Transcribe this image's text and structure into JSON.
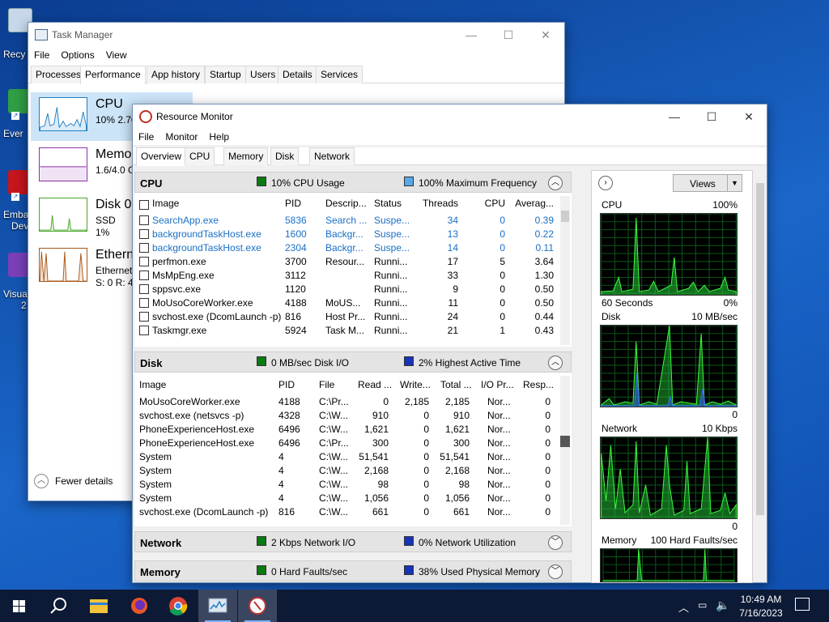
{
  "desktop": {
    "icons": [
      {
        "label": "Recy",
        "color": "#c8d8ea"
      },
      {
        "label": "Ever",
        "color": "#2f9e44"
      },
      {
        "label": "Emba",
        "sub": "Dev",
        "color": "#c4161c"
      },
      {
        "label": "Visua",
        "sub": "2",
        "color": "#7b3fb8"
      }
    ]
  },
  "task_manager": {
    "title": "Task Manager",
    "menu": [
      "File",
      "Options",
      "View"
    ],
    "tabs": [
      "Processes",
      "Performance",
      "App history",
      "Startup",
      "Users",
      "Details",
      "Services"
    ],
    "active_tab": "Performance",
    "sidebar": [
      {
        "name": "CPU",
        "sub1": "10% 2.70",
        "color": "#1f80c6"
      },
      {
        "name": "Memo",
        "sub1": "1.6/4.0 G",
        "color": "#8b2fa8"
      },
      {
        "name": "Disk 0",
        "sub1": "SSD",
        "sub2": "1%",
        "color": "#4aa529"
      },
      {
        "name": "Ethern",
        "sub1": "Ethernet",
        "sub2": "S: 0 R: 40",
        "color": "#a7581b"
      }
    ],
    "fewer_details": "Fewer details",
    "fewer_icon": "chevron-up-icon"
  },
  "resource_monitor": {
    "title": "Resource Monitor",
    "menu": [
      "File",
      "Monitor",
      "Help"
    ],
    "tabs": [
      "Overview",
      "CPU",
      "Memory",
      "Disk",
      "Network"
    ],
    "active_tab": "Overview",
    "cpu_section": {
      "title": "CPU",
      "ind1": {
        "text": "10% CPU Usage",
        "color": "#0a7a12"
      },
      "ind2": {
        "text": "100% Maximum Frequency",
        "color": "#5aa8e8"
      },
      "columns": [
        "Image",
        "PID",
        "Descrip...",
        "Status",
        "Threads",
        "CPU",
        "Averag..."
      ],
      "rows": [
        {
          "image": "SearchApp.exe",
          "pid": "5836",
          "desc": "Search ...",
          "status": "Suspe...",
          "threads": "34",
          "cpu": "0",
          "avg": "0.39",
          "blue": true
        },
        {
          "image": "backgroundTaskHost.exe",
          "pid": "1600",
          "desc": "Backgr...",
          "status": "Suspe...",
          "threads": "13",
          "cpu": "0",
          "avg": "0.22",
          "blue": true
        },
        {
          "image": "backgroundTaskHost.exe",
          "pid": "2304",
          "desc": "Backgr...",
          "status": "Suspe...",
          "threads": "14",
          "cpu": "0",
          "avg": "0.11",
          "blue": true
        },
        {
          "image": "perfmon.exe",
          "pid": "3700",
          "desc": "Resour...",
          "status": "Runni...",
          "threads": "17",
          "cpu": "5",
          "avg": "3.64",
          "blue": false
        },
        {
          "image": "MsMpEng.exe",
          "pid": "3112",
          "desc": "",
          "status": "Runni...",
          "threads": "33",
          "cpu": "0",
          "avg": "1.30",
          "blue": false
        },
        {
          "image": "sppsvc.exe",
          "pid": "1120",
          "desc": "",
          "status": "Runni...",
          "threads": "9",
          "cpu": "0",
          "avg": "0.50",
          "blue": false
        },
        {
          "image": "MoUsoCoreWorker.exe",
          "pid": "4188",
          "desc": "MoUS...",
          "status": "Runni...",
          "threads": "11",
          "cpu": "0",
          "avg": "0.50",
          "blue": false
        },
        {
          "image": "svchost.exe (DcomLaunch -p)",
          "pid": "816",
          "desc": "Host Pr...",
          "status": "Runni...",
          "threads": "24",
          "cpu": "0",
          "avg": "0.44",
          "blue": false
        },
        {
          "image": "Taskmgr.exe",
          "pid": "5924",
          "desc": "Task M...",
          "status": "Runni...",
          "threads": "21",
          "cpu": "1",
          "avg": "0.43",
          "blue": false
        }
      ]
    },
    "disk_section": {
      "title": "Disk",
      "ind1": {
        "text": "0 MB/sec Disk I/O",
        "color": "#0a7a12"
      },
      "ind2": {
        "text": "2% Highest Active Time",
        "color": "#1733b8"
      },
      "columns": [
        "Image",
        "PID",
        "File",
        "Read ...",
        "Write...",
        "Total ...",
        "I/O Pr...",
        "Resp..."
      ],
      "rows": [
        {
          "image": "MoUsoCoreWorker.exe",
          "pid": "4188",
          "file": "C:\\Pr...",
          "read": "0",
          "write": "2,185",
          "total": "2,185",
          "io": "Nor...",
          "resp": "0"
        },
        {
          "image": "svchost.exe (netsvcs -p)",
          "pid": "4328",
          "file": "C:\\W...",
          "read": "910",
          "write": "0",
          "total": "910",
          "io": "Nor...",
          "resp": "0"
        },
        {
          "image": "PhoneExperienceHost.exe",
          "pid": "6496",
          "file": "C:\\W...",
          "read": "1,621",
          "write": "0",
          "total": "1,621",
          "io": "Nor...",
          "resp": "0"
        },
        {
          "image": "PhoneExperienceHost.exe",
          "pid": "6496",
          "file": "C:\\Pr...",
          "read": "300",
          "write": "0",
          "total": "300",
          "io": "Nor...",
          "resp": "0"
        },
        {
          "image": "System",
          "pid": "4",
          "file": "C:\\W...",
          "read": "51,541",
          "write": "0",
          "total": "51,541",
          "io": "Nor...",
          "resp": "0"
        },
        {
          "image": "System",
          "pid": "4",
          "file": "C:\\W...",
          "read": "2,168",
          "write": "0",
          "total": "2,168",
          "io": "Nor...",
          "resp": "0"
        },
        {
          "image": "System",
          "pid": "4",
          "file": "C:\\W...",
          "read": "98",
          "write": "0",
          "total": "98",
          "io": "Nor...",
          "resp": "0"
        },
        {
          "image": "System",
          "pid": "4",
          "file": "C:\\W...",
          "read": "1,056",
          "write": "0",
          "total": "1,056",
          "io": "Nor...",
          "resp": "0"
        },
        {
          "image": "svchost.exe (DcomLaunch -p)",
          "pid": "816",
          "file": "C:\\W...",
          "read": "661",
          "write": "0",
          "total": "661",
          "io": "Nor...",
          "resp": "0"
        }
      ]
    },
    "network_section": {
      "title": "Network",
      "ind1": {
        "text": "2 Kbps Network I/O",
        "color": "#0a7a12"
      },
      "ind2": {
        "text": "0% Network Utilization",
        "color": "#1733b8"
      }
    },
    "memory_section": {
      "title": "Memory",
      "ind1": {
        "text": "0 Hard Faults/sec",
        "color": "#0a7a12"
      },
      "ind2": {
        "text": "38% Used Physical Memory",
        "color": "#1733b8"
      }
    },
    "side_panel": {
      "views_label": "Views",
      "graphs": [
        {
          "label": "CPU",
          "max": "100%",
          "foot_left": "60 Seconds",
          "foot_right": "0%"
        },
        {
          "label": "Disk",
          "max": "10 MB/sec",
          "foot_left": "",
          "foot_right": "0"
        },
        {
          "label": "Network",
          "max": "10 Kbps",
          "foot_left": "",
          "foot_right": "0"
        },
        {
          "label": "Memory",
          "max": "100 Hard Faults/sec",
          "foot_left": "",
          "foot_right": ""
        }
      ]
    }
  },
  "taskbar": {
    "items": [
      "start-icon",
      "search-icon",
      "file-explorer-icon",
      "firefox-icon",
      "chrome-icon",
      "task-manager-icon",
      "resource-monitor-icon"
    ],
    "time": "10:49 AM",
    "date": "7/16/2023",
    "accent": "#7fb3ff"
  }
}
